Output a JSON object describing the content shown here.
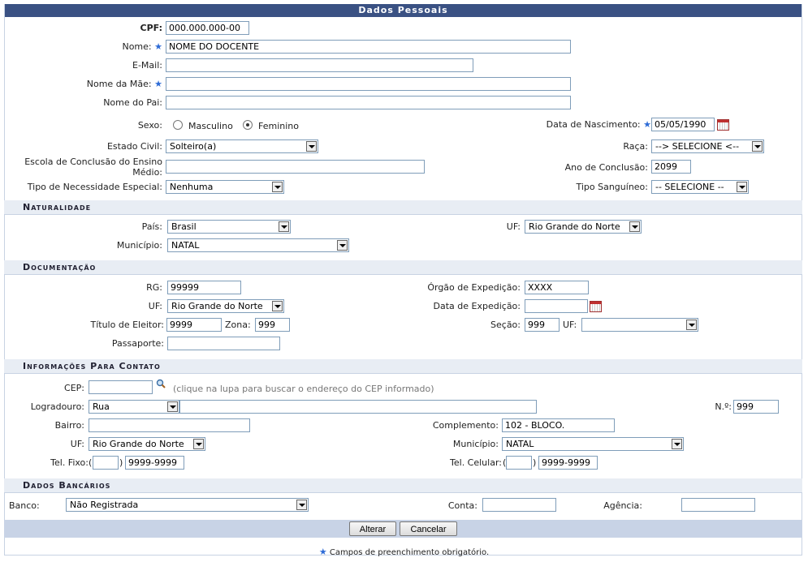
{
  "title": "Dados Pessoais",
  "fields": {
    "cpf_label": "CPF:",
    "cpf": "000.000.000-00",
    "nome_label": "Nome:",
    "nome": "NOME DO DOCENTE",
    "email_label": "E-Mail:",
    "email": "",
    "mae_label": "Nome da Mãe:",
    "mae": "",
    "pai_label": "Nome do Pai:",
    "pai": "",
    "sexo_label": "Sexo:",
    "sexo_masculino": "Masculino",
    "sexo_feminino": "Feminino",
    "sexo_selected": "Feminino",
    "nasc_label": "Data de Nascimento:",
    "nasc": "05/05/1990",
    "civil_label": "Estado Civil:",
    "civil": "Solteiro(a)",
    "raca_label": "Raça:",
    "raca": "--> SELECIONE <--",
    "escola_label_1": "Escola de Conclusão do Ensino",
    "escola_label_2": "Médio:",
    "escola": "",
    "ano_label": "Ano de Conclusão:",
    "ano": "2099",
    "necess_label": "Tipo de Necessidade Especial:",
    "necess": "Nenhuma",
    "sangue_label": "Tipo Sanguíneo:",
    "sangue": "-- SELECIONE --"
  },
  "naturalidade": {
    "title": "Naturalidade",
    "pais_label": "País:",
    "pais": "Brasil",
    "uf_label": "UF:",
    "uf": "Rio Grande do Norte",
    "municipio_label": "Município:",
    "municipio": "NATAL"
  },
  "documentacao": {
    "title": "Documentação",
    "rg_label": "RG:",
    "rg": "99999",
    "orgao_label": "Órgão de Expedição:",
    "orgao": "XXXX",
    "uf_label": "UF:",
    "uf": "Rio Grande do Norte",
    "data_exp_label": "Data de Expedição:",
    "data_exp": "",
    "titulo_label": "Título de Eleitor:",
    "titulo": "9999",
    "zona_label": "Zona:",
    "zona": "999",
    "secao_label": "Seção:",
    "secao": "999",
    "uf2_label": "UF:",
    "uf2": "",
    "passaporte_label": "Passaporte:",
    "passaporte": ""
  },
  "contato": {
    "title": "Informações Para Contato",
    "cep_label": "CEP:",
    "cep": "",
    "cep_hint": "(clique na lupa para buscar o endereço do CEP informado)",
    "logradouro_label": "Logradouro:",
    "logradouro_tipo": "Rua",
    "logradouro": "",
    "numero_label": "N.º:",
    "numero": "999",
    "bairro_label": "Bairro:",
    "bairro": "",
    "complemento_label": "Complemento:",
    "complemento": "102 - BLOCO.",
    "uf_label": "UF:",
    "uf": "Rio Grande do Norte",
    "municipio_label": "Município:",
    "municipio": "NATAL",
    "fixo_label": "Tel. Fixo:",
    "fixo_open": "(",
    "fixo_close": ")",
    "fixo_ddd": "",
    "fixo": "9999-9999",
    "celular_label": "Tel. Celular:",
    "celular_open": "(",
    "celular_close": ")",
    "celular_ddd": "",
    "celular": "9999-9999"
  },
  "bancarios": {
    "title": "Dados Bancários",
    "banco_label": "Banco:",
    "banco": "Não Registrada",
    "conta_label": "Conta:",
    "conta": "",
    "agencia_label": "Agência:",
    "agencia": ""
  },
  "buttons": {
    "alterar": "Alterar",
    "cancelar": "Cancelar"
  },
  "footer": {
    "star": "★",
    "note": "Campos de preenchimento obrigatório."
  },
  "colors": {
    "header": "#3a5183",
    "section": "#e8edf4",
    "star": "#2d6bd6",
    "buttonbar": "#c8d3e6"
  }
}
